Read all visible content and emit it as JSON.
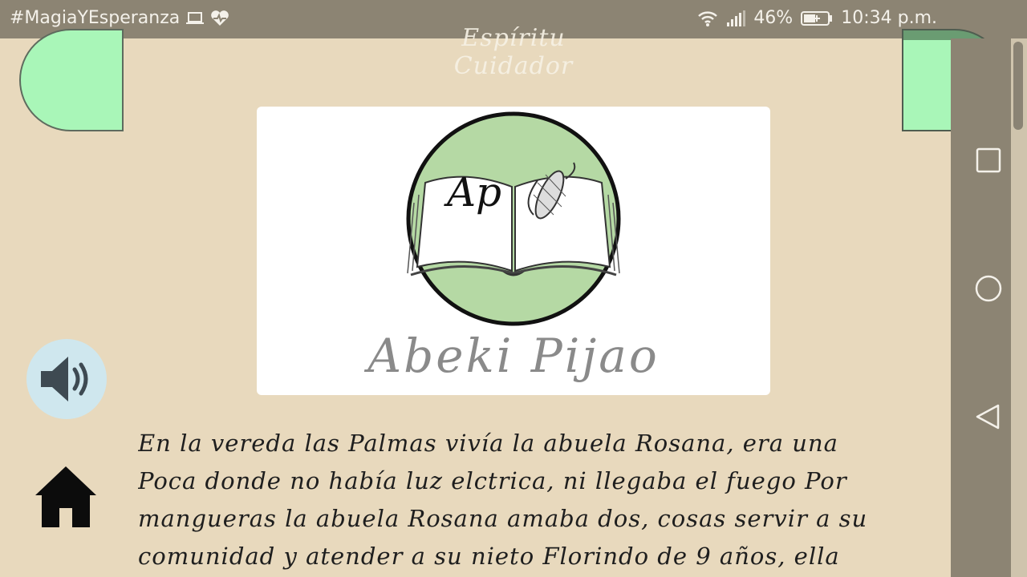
{
  "status_bar": {
    "notification_text": "#MagiaYEsperanza",
    "icons": [
      "laptop-icon",
      "heart-pulse-icon",
      "wifi-icon",
      "signal-icon",
      "battery-charging-icon"
    ],
    "battery": "46%",
    "time": "10:34 p.m."
  },
  "header": {
    "title": "Espíritu Cuidador"
  },
  "logo": {
    "monogram": "Ap",
    "brand_name": "Abeki Pijao"
  },
  "controls": {
    "left_corner_button": "green-tab",
    "right_corner_button": "green-tab",
    "speaker": "speaker-icon",
    "home": "home-icon"
  },
  "nav": {
    "buttons": [
      "recent-apps-icon",
      "home-circle-icon",
      "back-icon"
    ]
  },
  "story": {
    "text": "En la vereda las Palmas vivía la abuela Rosana, era una Poca donde no había luz elctrica, ni llegaba el fuego Por mangueras la abuela Rosana amaba dos, cosas servir a su comunidad y atender a su nieto Florindo de 9 años, ella"
  },
  "colors": {
    "background": "#e8d9bd",
    "bar": "#8c8473",
    "accent_green": "#a9f6b8",
    "logo_circle": "#b5d9a4"
  }
}
